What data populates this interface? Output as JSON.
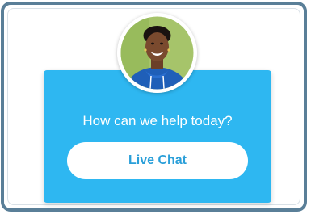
{
  "widget": {
    "prompt": "How can we help today?",
    "button_label": "Live Chat",
    "avatar_icon": "agent-avatar",
    "colors": {
      "card": "#2eb7f1",
      "button_text": "#2a9fd9",
      "frame_border": "#5a7f98"
    }
  }
}
